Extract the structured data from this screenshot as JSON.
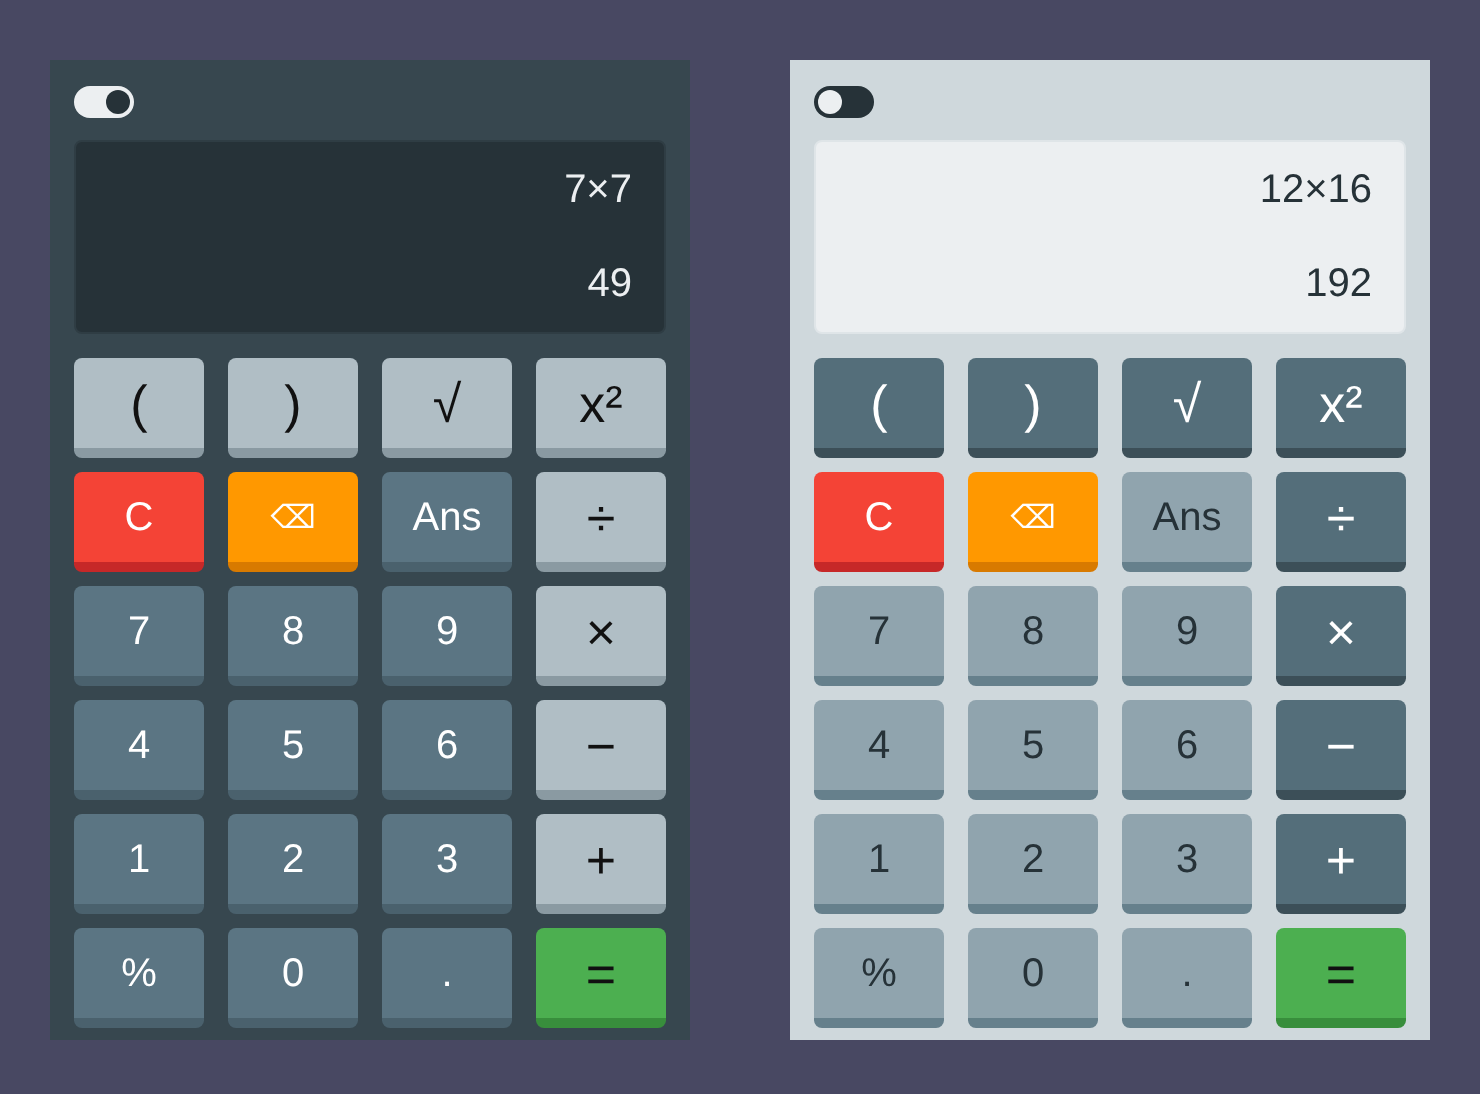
{
  "calculators": [
    {
      "kind": "dark",
      "toggle": {
        "on": true
      },
      "expression": "7×7",
      "result": "49",
      "keys": [
        {
          "label": "(",
          "kind": "func"
        },
        {
          "label": ")",
          "kind": "func"
        },
        {
          "label": "√",
          "kind": "func"
        },
        {
          "label": "x²",
          "kind": "func"
        },
        {
          "label": "C",
          "kind": "clear"
        },
        {
          "label": "⌫",
          "kind": "back"
        },
        {
          "label": "Ans",
          "kind": "num"
        },
        {
          "label": "÷",
          "kind": "op"
        },
        {
          "label": "7",
          "kind": "num"
        },
        {
          "label": "8",
          "kind": "num"
        },
        {
          "label": "9",
          "kind": "num"
        },
        {
          "label": "×",
          "kind": "op"
        },
        {
          "label": "4",
          "kind": "num"
        },
        {
          "label": "5",
          "kind": "num"
        },
        {
          "label": "6",
          "kind": "num"
        },
        {
          "label": "−",
          "kind": "op"
        },
        {
          "label": "1",
          "kind": "num"
        },
        {
          "label": "2",
          "kind": "num"
        },
        {
          "label": "3",
          "kind": "num"
        },
        {
          "label": "+",
          "kind": "op"
        },
        {
          "label": "%",
          "kind": "num"
        },
        {
          "label": "0",
          "kind": "num"
        },
        {
          "label": ".",
          "kind": "num"
        },
        {
          "label": "=",
          "kind": "equals"
        }
      ]
    },
    {
      "kind": "light",
      "toggle": {
        "on": false
      },
      "expression": "12×16",
      "result": "192",
      "keys": [
        {
          "label": "(",
          "kind": "func"
        },
        {
          "label": ")",
          "kind": "func"
        },
        {
          "label": "√",
          "kind": "func"
        },
        {
          "label": "x²",
          "kind": "func"
        },
        {
          "label": "C",
          "kind": "clear"
        },
        {
          "label": "⌫",
          "kind": "back"
        },
        {
          "label": "Ans",
          "kind": "num"
        },
        {
          "label": "÷",
          "kind": "op"
        },
        {
          "label": "7",
          "kind": "num"
        },
        {
          "label": "8",
          "kind": "num"
        },
        {
          "label": "9",
          "kind": "num"
        },
        {
          "label": "×",
          "kind": "op"
        },
        {
          "label": "4",
          "kind": "num"
        },
        {
          "label": "5",
          "kind": "num"
        },
        {
          "label": "6",
          "kind": "num"
        },
        {
          "label": "−",
          "kind": "op"
        },
        {
          "label": "1",
          "kind": "num"
        },
        {
          "label": "2",
          "kind": "num"
        },
        {
          "label": "3",
          "kind": "num"
        },
        {
          "label": "+",
          "kind": "op"
        },
        {
          "label": "%",
          "kind": "num"
        },
        {
          "label": "0",
          "kind": "num"
        },
        {
          "label": ".",
          "kind": "num"
        },
        {
          "label": "=",
          "kind": "equals"
        }
      ]
    }
  ]
}
